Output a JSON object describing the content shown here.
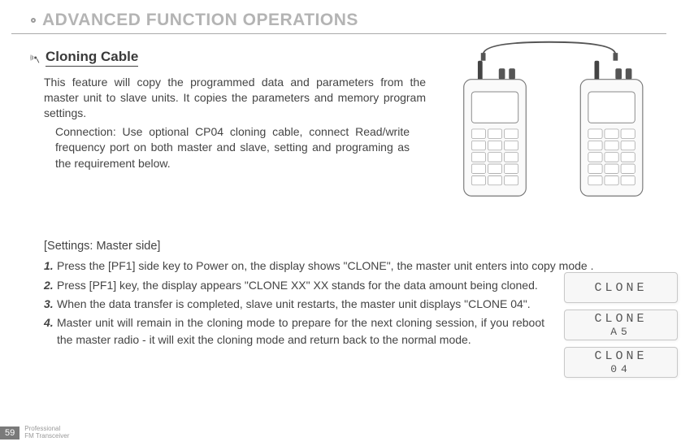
{
  "header": {
    "title": "ADVANCED FUNCTION OPERATIONS"
  },
  "section": {
    "title": "Cloning Cable",
    "intro": "This feature will copy the programmed data and parameters from the master unit to slave units. It copies the parameters and memory program settings.",
    "connection": "Connection: Use optional CP04 cloning cable, connect Read/write frequency port on both master and slave, setting and programing as the requirement below."
  },
  "settings_label": "[Settings: Master side]",
  "steps": [
    "Press the [PF1] side key to Power on, the display shows \"CLONE\", the master unit  enters into copy mode .",
    "Press [PF1] key, the display appears \"CLONE XX\" XX stands for the data amount being cloned.",
    " When the data transfer is completed, slave unit restarts, the master unit displays \"CLONE 04\".",
    "Master unit will remain in the cloning mode to prepare for the next cloning session, if you reboot the master radio - it will exit the cloning mode and return back to the normal mode."
  ],
  "displays": [
    {
      "line1": "CLONE",
      "line2": ""
    },
    {
      "line1": "CLONE",
      "line2": "A5"
    },
    {
      "line1": "CLONE",
      "line2": "04"
    }
  ],
  "footer": {
    "page": "59",
    "line1": "Professional",
    "line2": "FM Transceiver"
  }
}
